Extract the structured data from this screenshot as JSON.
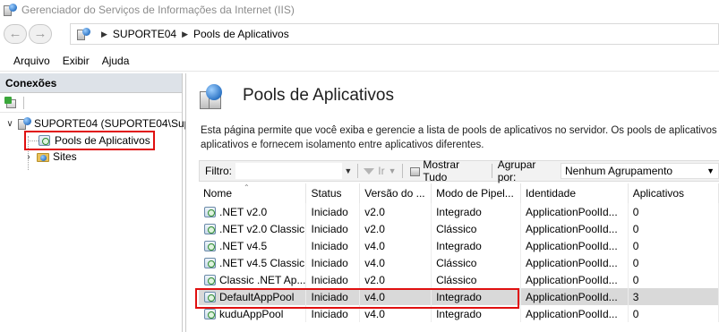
{
  "window": {
    "title": "Gerenciador do Serviços de Informações da Internet (IIS)"
  },
  "address": {
    "crumbs": [
      "SUPORTE04",
      "Pools de Aplicativos"
    ]
  },
  "menu": {
    "items": [
      "Arquivo",
      "Exibir",
      "Ajuda"
    ]
  },
  "connections": {
    "header": "Conexões",
    "server": "SUPORTE04 (SUPORTE04\\Sup",
    "pools": "Pools de Aplicativos",
    "sites": "Sites"
  },
  "page": {
    "title": "Pools de Aplicativos",
    "desc_line1": "Esta página permite que você exiba e gerencie a lista de pools de aplicativos no servidor. Os pools de aplicativos",
    "desc_line2": "aplicativos e fornecem isolamento entre aplicativos diferentes."
  },
  "filter": {
    "label": "Filtro:",
    "go": "Ir",
    "show_all": "Mostrar Tudo",
    "group_label": "Agrupar por:",
    "group_value": "Nenhum Agrupamento"
  },
  "columns": [
    "Nome",
    "Status",
    "Versão do ...",
    "Modo de Pipel...",
    "Identidade",
    "Aplicativos"
  ],
  "rows": [
    [
      ".NET v2.0",
      "Iniciado",
      "v2.0",
      "Integrado",
      "ApplicationPoolId...",
      "0"
    ],
    [
      ".NET v2.0 Classic",
      "Iniciado",
      "v2.0",
      "Clássico",
      "ApplicationPoolId...",
      "0"
    ],
    [
      ".NET v4.5",
      "Iniciado",
      "v4.0",
      "Integrado",
      "ApplicationPoolId...",
      "0"
    ],
    [
      ".NET v4.5 Classic",
      "Iniciado",
      "v4.0",
      "Clássico",
      "ApplicationPoolId...",
      "0"
    ],
    [
      "Classic .NET Ap...",
      "Iniciado",
      "v2.0",
      "Clássico",
      "ApplicationPoolId...",
      "0"
    ],
    [
      "DefaultAppPool",
      "Iniciado",
      "v4.0",
      "Integrado",
      "ApplicationPoolId...",
      "3"
    ],
    [
      "kuduAppPool",
      "Iniciado",
      "v4.0",
      "Integrado",
      "ApplicationPoolId...",
      "0"
    ]
  ],
  "colors": {
    "highlight": "#e01010",
    "selected_row": "#d9d9d9",
    "header_bg": "#dde2e8"
  }
}
